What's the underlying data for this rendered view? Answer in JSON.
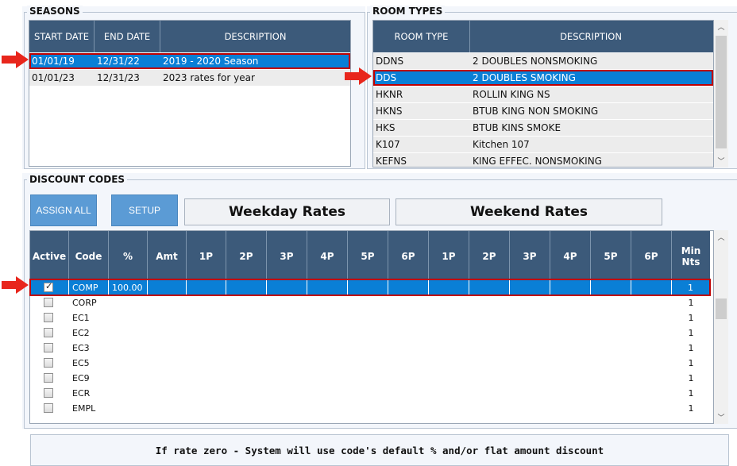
{
  "seasons": {
    "legend": "SEASONS",
    "headers": [
      "START DATE",
      "END DATE",
      "DESCRIPTION"
    ],
    "rows": [
      [
        "01/01/19",
        "12/31/22",
        "2019 - 2020 Season"
      ],
      [
        "01/01/23",
        "12/31/23",
        "2023 rates for year"
      ]
    ],
    "selected_index": 0
  },
  "room_types": {
    "legend": "ROOM TYPES",
    "headers": [
      "ROOM TYPE",
      "DESCRIPTION"
    ],
    "rows": [
      [
        "DDNS",
        "2 DOUBLES NONSMOKING"
      ],
      [
        "DDS",
        "2 DOUBLES SMOKING"
      ],
      [
        "HKNR",
        "ROLLIN KING NS"
      ],
      [
        "HKNS",
        "BTUB KING NON SMOKING"
      ],
      [
        "HKS",
        "BTUB KINS SMOKE"
      ],
      [
        "K107",
        "Kitchen 107"
      ],
      [
        "KEFNS",
        "KING EFFEC. NONSMOKING"
      ]
    ],
    "selected_index": 1
  },
  "discount_codes": {
    "legend": "DISCOUNT CODES",
    "assign_all_label": "ASSIGN ALL",
    "setup_label": "SETUP",
    "weekday_label": "Weekday Rates",
    "weekend_label": "Weekend Rates",
    "headers": [
      "Active",
      "Code",
      "%",
      "Amt",
      "1P",
      "2P",
      "3P",
      "4P",
      "5P",
      "6P",
      "1P",
      "2P",
      "3P",
      "4P",
      "5P",
      "6P",
      "Min Nts"
    ],
    "rows": [
      {
        "active": true,
        "code": "COMP",
        "pct": "100.00",
        "min": "1"
      },
      {
        "active": false,
        "code": "CORP",
        "pct": "",
        "min": "1"
      },
      {
        "active": false,
        "code": "EC1",
        "pct": "",
        "min": "1"
      },
      {
        "active": false,
        "code": "EC2",
        "pct": "",
        "min": "1"
      },
      {
        "active": false,
        "code": "EC3",
        "pct": "",
        "min": "1"
      },
      {
        "active": false,
        "code": "EC5",
        "pct": "",
        "min": "1"
      },
      {
        "active": false,
        "code": "EC9",
        "pct": "",
        "min": "1"
      },
      {
        "active": false,
        "code": "ECR",
        "pct": "",
        "min": "1"
      },
      {
        "active": false,
        "code": "EMPL",
        "pct": "",
        "min": "1"
      }
    ],
    "selected_index": 0
  },
  "footer_note": "If rate zero - System will use code's default % and/or flat amount discount",
  "colors": {
    "header_bg": "#3c5a7a",
    "selection_bg": "#0a7fd6",
    "highlight_border": "#c00000",
    "button_bg": "#5b9bd5",
    "arrow": "#e8261c"
  }
}
